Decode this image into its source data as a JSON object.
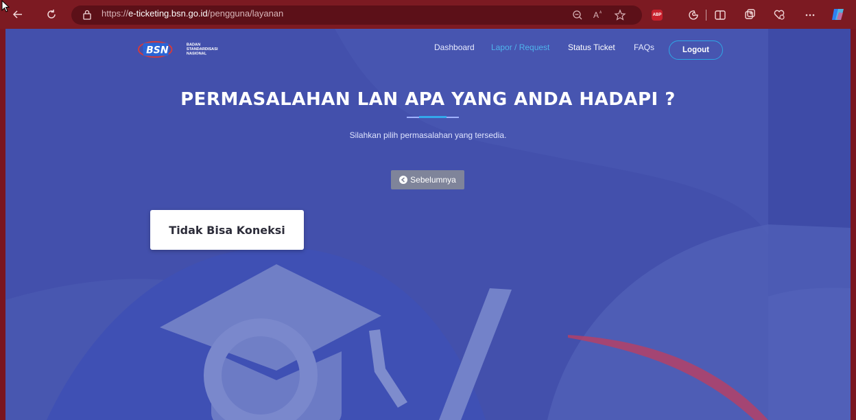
{
  "browser": {
    "url_proto": "https://",
    "url_host": "e-ticketing.bsn.go.id",
    "url_path": "/pengguna/layanan",
    "abp_label": "ABP"
  },
  "header": {
    "logo_text": "BSN",
    "logo_lines": [
      "BADAN",
      "STANDARDISASI",
      "NASIONAL"
    ],
    "nav": {
      "dashboard": "Dashboard",
      "lapor": "Lapor / Request",
      "status": "Status Ticket",
      "faqs": "FAQs"
    },
    "logout_label": "Logout"
  },
  "main": {
    "title": "PERMASALAHAN LAN APA YANG ANDA HADAPI ?",
    "subtitle": "Silahkan pilih permasalahan yang tersedia.",
    "prev_label": "Sebelumnya",
    "issues": [
      "Tidak Bisa Koneksi"
    ]
  },
  "colors": {
    "page_bg": "#4350ac",
    "accent": "#2fa7e6",
    "browser_bar": "#7c1a22"
  }
}
